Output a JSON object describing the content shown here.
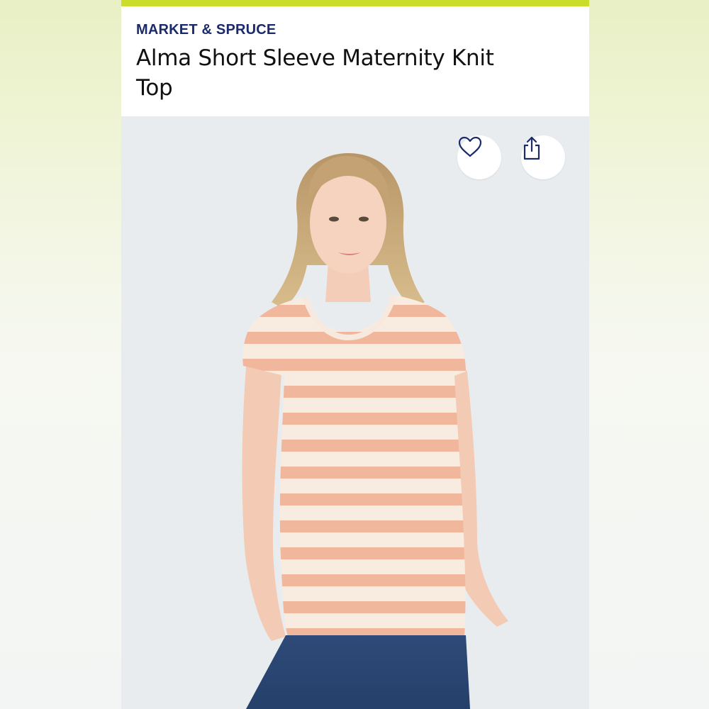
{
  "colors": {
    "accent": "#c9dd2a",
    "brand_text": "#1a2a6b",
    "photo_background": "#e9ecef"
  },
  "product": {
    "brand": "MARKET & SPRUCE",
    "title": "Alma Short Sleeve Maternity Knit Top"
  },
  "actions": {
    "favorite_icon": "heart-outline-icon",
    "share_icon": "share-upload-icon"
  },
  "image": {
    "subject": "model-wearing-striped-top-icon"
  }
}
